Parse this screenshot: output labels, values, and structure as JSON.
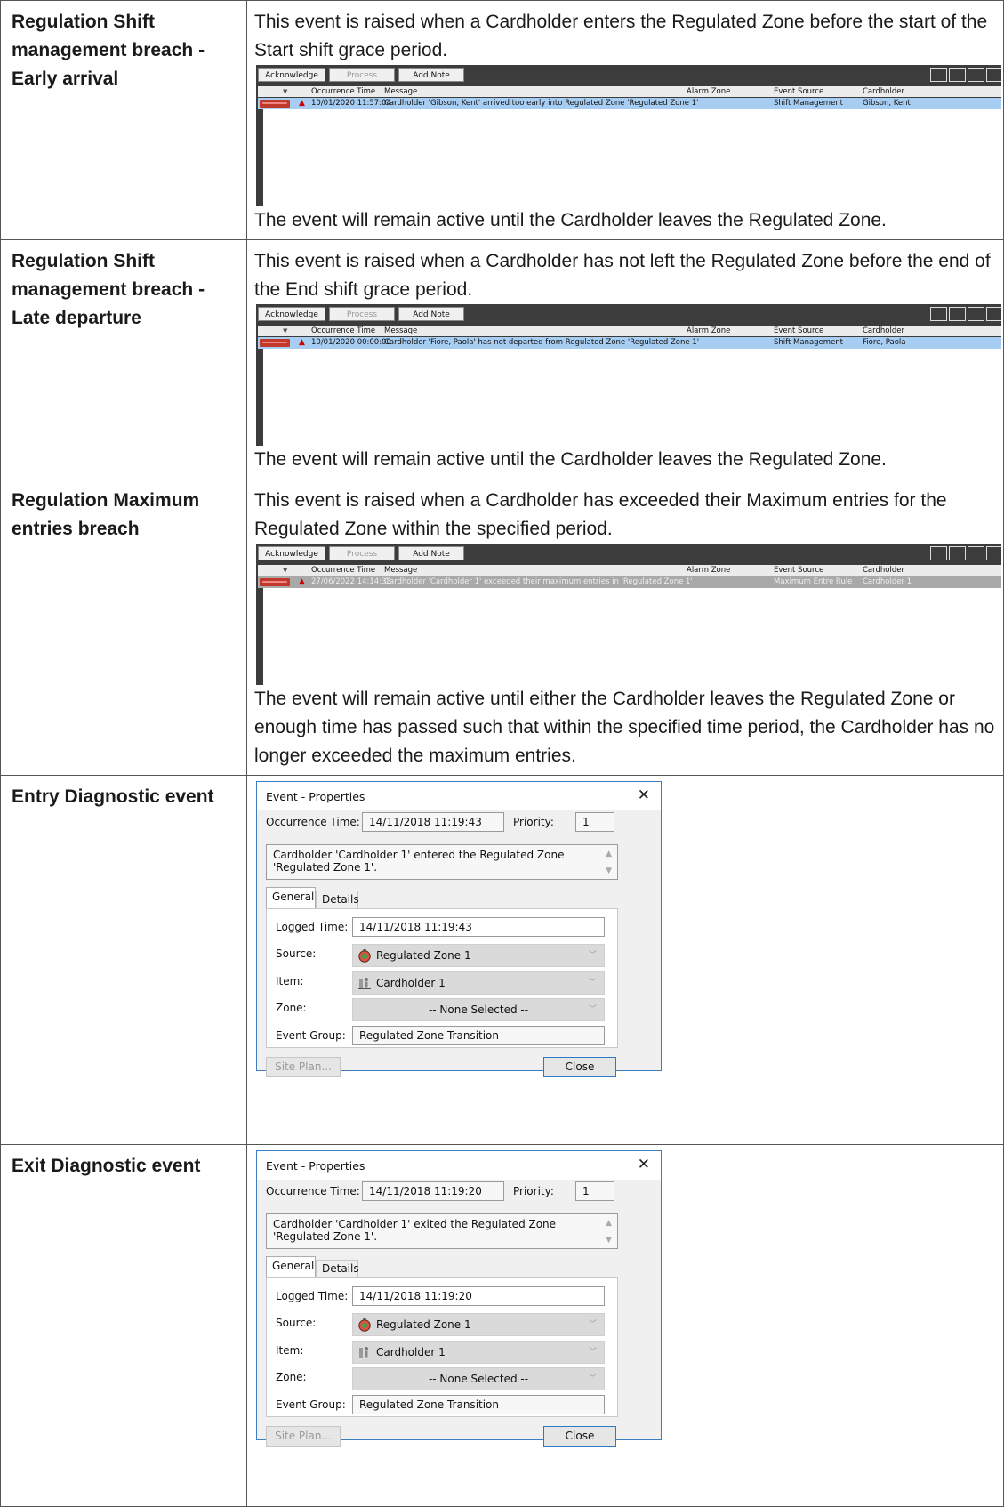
{
  "rows": [
    {
      "label": "Regulation Shift management breach - Early arrival",
      "intro": "This event is raised when a Cardholder enters the Regulated Zone before the start of the Start shift grace period.",
      "outro": "The event will remain active until the Cardholder leaves the Regulated Zone.",
      "viewer": {
        "buttons": {
          "acknowledge": "Acknowledge",
          "process": "Process",
          "add_note": "Add Note"
        },
        "columns": {
          "occurrence_time": "Occurrence Time",
          "message": "Message",
          "alarm_zone": "Alarm Zone",
          "event_source": "Event Source",
          "cardholder": "Cardholder"
        },
        "alarm": {
          "time": "10/01/2020 11:57:04",
          "message": "Cardholder 'Gibson, Kent' arrived too early into Regulated Zone 'Regulated Zone 1'",
          "alarm_zone": "",
          "event_source": "Shift Management",
          "cardholder": "Gibson, Kent"
        }
      }
    },
    {
      "label": "Regulation Shift management breach - Late departure",
      "intro": "This event is raised when a Cardholder has not left the Regulated Zone before the end of the End shift grace period.",
      "outro": "The event will remain active until the Cardholder leaves the Regulated Zone.",
      "viewer": {
        "buttons": {
          "acknowledge": "Acknowledge",
          "process": "Process",
          "add_note": "Add Note"
        },
        "columns": {
          "occurrence_time": "Occurrence Time",
          "message": "Message",
          "alarm_zone": "Alarm Zone",
          "event_source": "Event Source",
          "cardholder": "Cardholder"
        },
        "alarm": {
          "time": "10/01/2020 00:00:00",
          "message": "Cardholder 'Fiore, Paola' has not departed from Regulated Zone 'Regulated Zone 1'",
          "alarm_zone": "",
          "event_source": "Shift Management",
          "cardholder": "Fiore, Paola"
        }
      }
    },
    {
      "label": "Regulation Maximum entries breach",
      "intro": "This event is raised when a Cardholder has exceeded their Maximum entries for the Regulated Zone within the specified period.",
      "outro": "The event will remain active until either the Cardholder leaves the Regulated Zone or enough time has passed such that within the specified time period, the Cardholder has no longer exceeded the maximum entries.",
      "viewer": {
        "buttons": {
          "acknowledge": "Acknowledge",
          "process": "Process",
          "add_note": "Add Note"
        },
        "columns": {
          "occurrence_time": "Occurrence Time",
          "message": "Message",
          "alarm_zone": "Alarm Zone",
          "event_source": "Event Source",
          "cardholder": "Cardholder"
        },
        "alarm": {
          "time": "27/06/2022 14:14:38",
          "message": "Cardholder 'Cardholder 1' exceeded their maximum entries in 'Regulated Zone 1'",
          "alarm_zone": "",
          "event_source": "Maximum Entre Rule",
          "cardholder": "Cardholder 1"
        }
      }
    },
    {
      "label": "Entry Diagnostic event",
      "dialog": {
        "title": "Event - Properties",
        "occurrence_label": "Occurrence Time:",
        "occurrence_value": "14/11/2018 11:19:43",
        "priority_label": "Priority:",
        "priority_value": "1",
        "message": "Cardholder 'Cardholder 1' entered the Regulated Zone 'Regulated Zone 1'.",
        "tab_general": "General",
        "tab_details": "Details",
        "logged_label": "Logged Time:",
        "logged_value": "14/11/2018 11:19:43",
        "source_label": "Source:",
        "source_value": "Regulated Zone 1",
        "item_label": "Item:",
        "item_value": "Cardholder 1",
        "zone_label": "Zone:",
        "zone_value": "-- None Selected --",
        "group_label": "Event Group:",
        "group_value": "Regulated Zone Transition",
        "site_plan": "Site Plan...",
        "close": "Close"
      }
    },
    {
      "label": "Exit Diagnostic event",
      "dialog": {
        "title": "Event - Properties",
        "occurrence_label": "Occurrence Time:",
        "occurrence_value": "14/11/2018 11:19:20",
        "priority_label": "Priority:",
        "priority_value": "1",
        "message": "Cardholder 'Cardholder 1' exited the Regulated Zone 'Regulated Zone 1'.",
        "tab_general": "General",
        "tab_details": "Details",
        "logged_label": "Logged Time:",
        "logged_value": "14/11/2018 11:19:20",
        "source_label": "Source:",
        "source_value": "Regulated Zone 1",
        "item_label": "Item:",
        "item_value": "Cardholder 1",
        "zone_label": "Zone:",
        "zone_value": "-- None Selected --",
        "group_label": "Event Group:",
        "group_value": "Regulated Zone Transition",
        "site_plan": "Site Plan...",
        "close": "Close"
      }
    }
  ],
  "icons": {
    "zone_icon": "regulated-zone-icon",
    "cardholder_icon": "cardholder-icon",
    "alarm_arrow": "red-arrow-icon",
    "close_icon": "close-icon"
  }
}
